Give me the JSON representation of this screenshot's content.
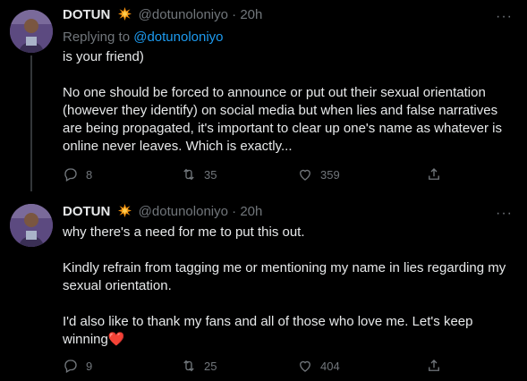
{
  "tweets": [
    {
      "name": "DOTUN",
      "handle": "@dotunoloniyo",
      "separator": "·",
      "time": "20h",
      "more": "···",
      "reply_prefix": "Replying to ",
      "reply_handle": "@dotunoloniyo",
      "text": "is your friend)\n\nNo one should be forced to announce or put out their sexual orientation (however they identify) on social media but when lies and false narratives are being propagated, it's important to clear up one's name as whatever is online never leaves. Which is exactly...",
      "replies": "8",
      "retweets": "35",
      "likes": "359"
    },
    {
      "name": "DOTUN",
      "handle": "@dotunoloniyo",
      "separator": "·",
      "time": "20h",
      "more": "···",
      "text": "why there's a need for me to put this out.\n\nKindly refrain from tagging me or mentioning my name in lies regarding my sexual orientation.\n\nI'd also like to thank my fans and all of those who love me. Let's keep winning",
      "text_emoji": "❤️",
      "replies": "9",
      "retweets": "25",
      "likes": "404"
    }
  ],
  "icons": {
    "name_badge": "collision-emoji",
    "reply": "reply-icon",
    "retweet": "retweet-icon",
    "like": "heart-icon",
    "share": "share-icon"
  },
  "colors": {
    "background": "#000000",
    "text": "#e7e9ea",
    "muted": "#71767b",
    "link": "#1d9bf0",
    "heart": "#f91880"
  }
}
